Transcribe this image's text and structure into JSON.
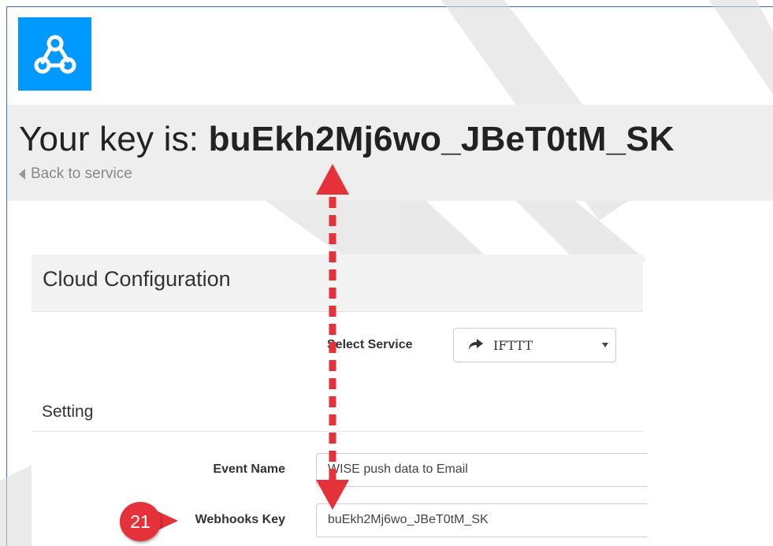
{
  "header": {
    "logo_icon": "webhooks-icon",
    "brand_color": "#0099ff"
  },
  "key_section": {
    "prefix": "Your key is: ",
    "key": "buEkh2Mj6wo_JBeT0tM_SK",
    "back_link": "Back to service"
  },
  "panel": {
    "title": "Cloud Configuration",
    "select_service_label": "Select Service",
    "select_service_value": "IFTTT",
    "select_service_icon": "share-arrow-icon",
    "setting_title": "Setting",
    "fields": [
      {
        "label": "Event Name",
        "value": "WISE push data to Email"
      },
      {
        "label": "Webhooks Key",
        "value": "buEkh2Mj6wo_JBeT0tM_SK"
      }
    ]
  },
  "annotation": {
    "step_number": "21",
    "accent_color": "#e5323a"
  }
}
